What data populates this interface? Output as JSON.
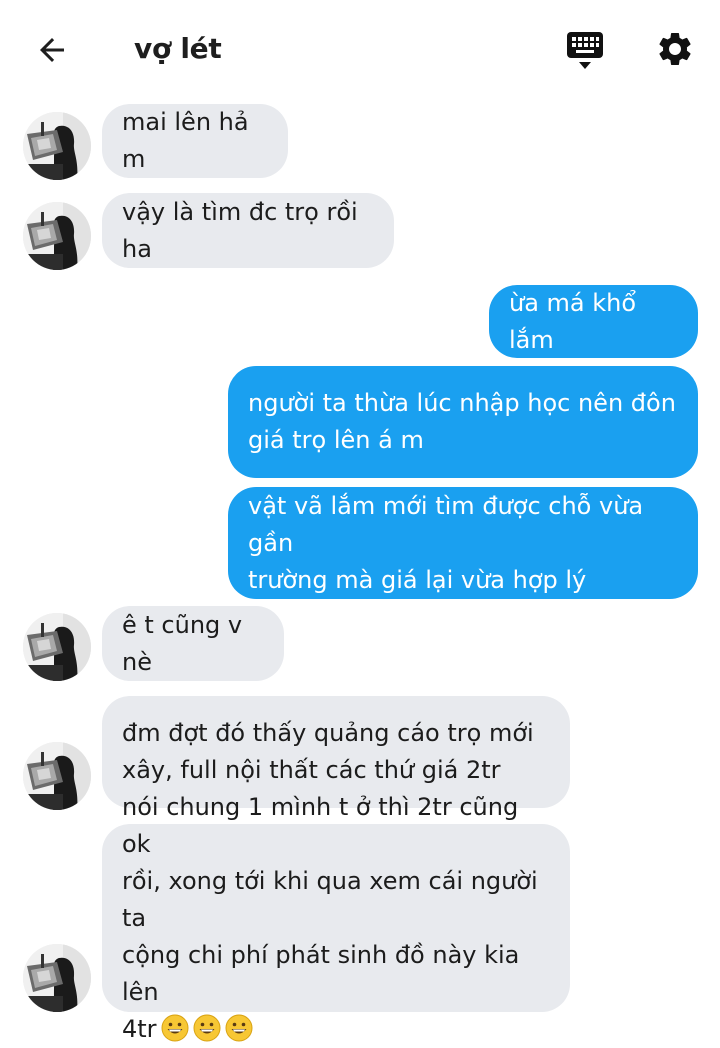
{
  "header": {
    "back_icon": "arrow-left-icon",
    "title": "vợ lét",
    "keyboard_icon": "keyboard-icon",
    "settings_icon": "gear-icon"
  },
  "messages": [
    {
      "sender": "other",
      "text": "mai lên hả m"
    },
    {
      "sender": "other",
      "text": "vậy là tìm đc trọ rồi ha"
    },
    {
      "sender": "me",
      "text": "ừa má khổ lắm"
    },
    {
      "sender": "me",
      "text": "người ta thừa lúc nhập học nên đôn\ngiá trọ lên á m"
    },
    {
      "sender": "me",
      "text": "vật vã lắm mới tìm được chỗ vừa gần\ntrường mà giá lại vừa hợp lý"
    },
    {
      "sender": "other",
      "text": "ê t cũng v nè"
    },
    {
      "sender": "other",
      "text": "đm đợt đó thấy quảng cáo trọ mới\nxây, full nội thất các thứ giá 2tr"
    },
    {
      "sender": "other",
      "text": "nói chung 1 mình t ở thì 2tr cũng ok\nrồi, xong tới khi qua xem cái người ta\ncộng chi phí phát sinh đồ này kia lên\n4tr",
      "emoji": [
        "grinning-face-emoji",
        "grinning-face-emoji",
        "grinning-face-emoji"
      ]
    }
  ],
  "colors": {
    "outgoing_bubble": "#1aa0f0",
    "incoming_bubble": "#e8eaee",
    "background": "#ffffff"
  }
}
